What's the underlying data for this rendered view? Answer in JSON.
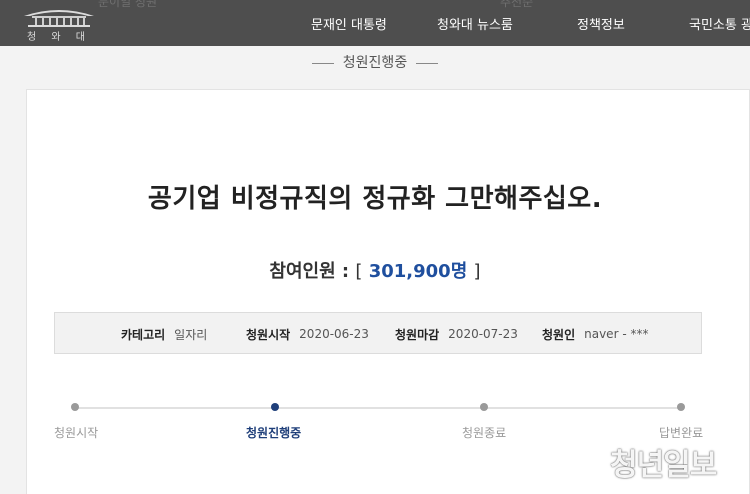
{
  "header": {
    "logo_text": "청 와 대",
    "ghost_left": "문이일 청원",
    "ghost_right": "추천순",
    "nav": [
      "문재인 대통령",
      "청와대 뉴스룸",
      "정책정보",
      "국민소통 광"
    ]
  },
  "petition": {
    "status": "청원진행중",
    "title": "공기업 비정규직의 정규화 그만해주십오.",
    "count_label": "참여인원 :",
    "count_open": "[",
    "count_value": "301,900명",
    "count_close": "]",
    "info": [
      {
        "key": "카테고리",
        "value": "일자리"
      },
      {
        "key": "청원시작",
        "value": "2020-06-23"
      },
      {
        "key": "청원마감",
        "value": "2020-07-23"
      },
      {
        "key": "청원인",
        "value": "naver - ***"
      }
    ],
    "steps": [
      "청원시작",
      "청원진행중",
      "청원종료",
      "답변완료"
    ],
    "active_step": 1
  },
  "watermark": "청년일보",
  "colors": {
    "header_bg": "#4e4e4e",
    "accent": "#1f3f7a",
    "count_blue": "#1f4f9e"
  }
}
